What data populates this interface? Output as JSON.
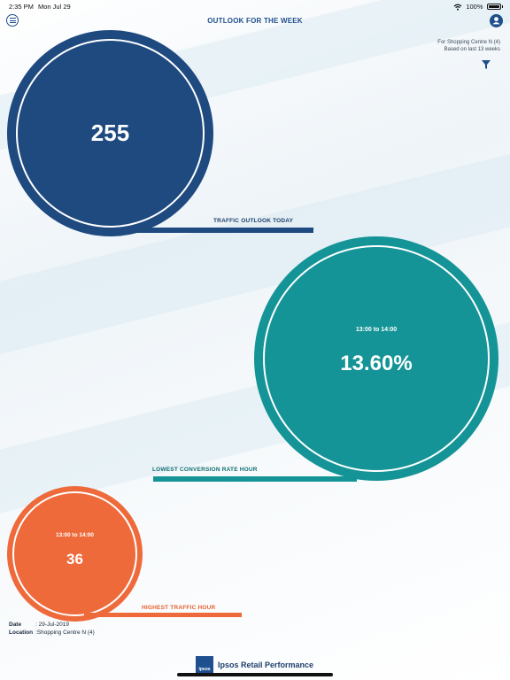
{
  "status_bar": {
    "time": "2:35 PM",
    "date": "Mon Jul 29",
    "battery": "100%"
  },
  "header": {
    "title": "OUTLOOK FOR THE WEEK"
  },
  "filter_info": {
    "line1": "For Shopping Centre N (4)",
    "line2": "Based on last 13 weeks"
  },
  "cards": {
    "traffic": {
      "value": "255",
      "caption": "TRAFFIC OUTLOOK TODAY",
      "color": "#1e4a80"
    },
    "lowest_conversion": {
      "time_range": "13:00 to 14:00",
      "value": "13.60%",
      "caption": "LOWEST CONVERSION RATE HOUR",
      "color": "#149497"
    },
    "highest_traffic": {
      "time_range": "13:00 to 14:00",
      "value": "36",
      "caption": "HIGHEST TRAFFIC HOUR",
      "color": "#ee6a3a"
    }
  },
  "meta": {
    "date_label": "Date",
    "date_value": ": 29-Jul-2019",
    "location_label": "Location",
    "location_value": ":Shopping Centre N (4)"
  },
  "brand": {
    "logo_text": "ipsos",
    "name": "Ipsos Retail Performance"
  },
  "icons": [
    "menu-icon",
    "wifi-icon",
    "battery-icon",
    "user-icon",
    "filter-icon"
  ]
}
